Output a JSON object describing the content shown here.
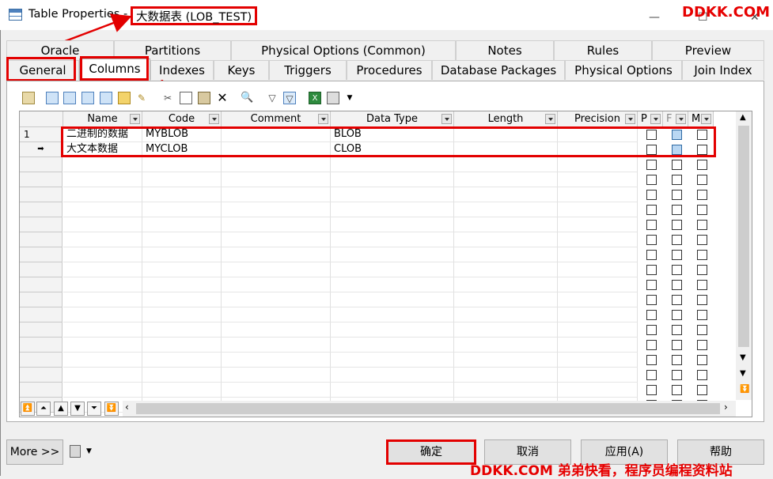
{
  "window": {
    "title": "Table Properties - ",
    "object": "大数据表 (LOB_TEST)",
    "minimize": "—",
    "maximize": "☐",
    "close": "✕"
  },
  "watermark": {
    "top": "DDKK.COM",
    "bottom": "DDKK.COM 弟弟快看，程序员编程资料站"
  },
  "tabs_row1": [
    "Oracle",
    "Partitions",
    "Physical Options (Common)",
    "Notes",
    "Rules",
    "Preview"
  ],
  "tabs_row2": [
    "General",
    "Columns",
    "Indexes",
    "Keys",
    "Triggers",
    "Procedures",
    "Database Packages",
    "Physical Options",
    "Join Index"
  ],
  "active_tab": "Columns",
  "toolbar": {
    "icons": [
      "properties-icon",
      "insert-row-icon",
      "add-row-icon",
      "add-columns-icon",
      "replicate-icon",
      "new-icon",
      "wizard-icon",
      "cut-icon",
      "copy-icon",
      "paste-icon",
      "delete-icon",
      "find-icon",
      "filter-icon",
      "filter-active-icon",
      "excel-icon",
      "print-icon",
      "dropdown-icon"
    ]
  },
  "grid": {
    "columns": [
      "Name",
      "Code",
      "Comment",
      "Data Type",
      "Length",
      "Precision",
      "P",
      "F",
      "M"
    ],
    "rows": [
      {
        "marker": "1",
        "name": "二进制的数据",
        "code": "MYBLOB",
        "comment": "",
        "data_type": "BLOB",
        "length": "",
        "precision": ""
      },
      {
        "marker": "➡",
        "name": "大文本数据",
        "code": "MYCLOB",
        "comment": "",
        "data_type": "CLOB",
        "length": "",
        "precision": ""
      }
    ]
  },
  "nav_buttons": [
    "⏫",
    "⏶",
    "▲",
    "▼",
    "⏷",
    "⏬"
  ],
  "buttons": {
    "more": "More >>",
    "ok": "确定",
    "cancel": "取消",
    "apply": "应用(A)",
    "help": "帮助"
  }
}
